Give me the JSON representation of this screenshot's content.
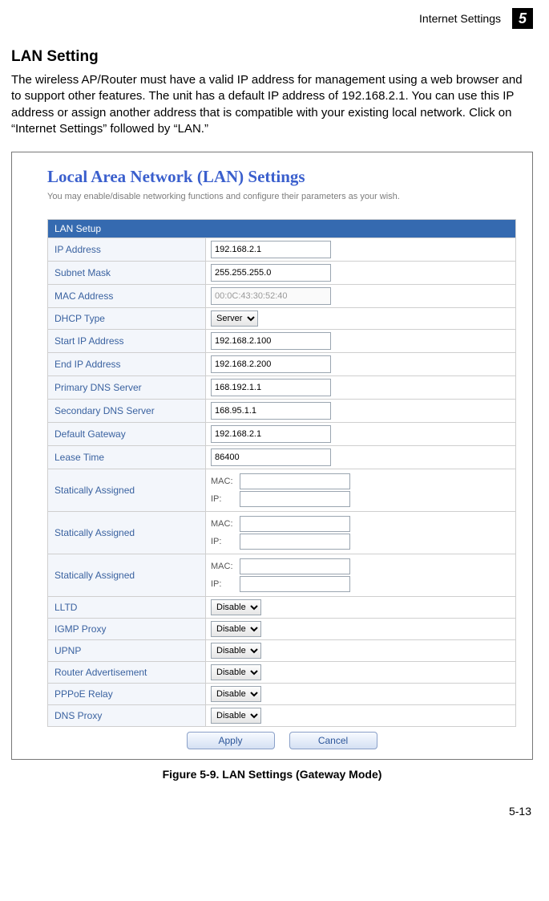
{
  "header": {
    "section_title": "Internet Settings",
    "chapter_number": "5"
  },
  "body": {
    "heading": "LAN Setting",
    "intro": "The wireless AP/Router must have a valid IP address for management using a web browser and to support other features. The unit has a default IP address of 192.168.2.1. You can use this IP address or assign another address that is compatible with your existing local network. Click on “Internet Settings” followed by “LAN.”"
  },
  "panel": {
    "title": "Local Area Network (LAN) Settings",
    "subtitle": "You may enable/disable networking functions and configure their parameters as your wish.",
    "table_header": "LAN Setup",
    "rows": {
      "ip_address": {
        "label": "IP Address",
        "value": "192.168.2.1"
      },
      "subnet_mask": {
        "label": "Subnet Mask",
        "value": "255.255.255.0"
      },
      "mac_address": {
        "label": "MAC Address",
        "value": "00:0C:43:30:52:40"
      },
      "dhcp_type": {
        "label": "DHCP Type",
        "value": "Server"
      },
      "start_ip": {
        "label": "Start IP Address",
        "value": "192.168.2.100"
      },
      "end_ip": {
        "label": "End IP Address",
        "value": "192.168.2.200"
      },
      "primary_dns": {
        "label": "Primary DNS Server",
        "value": "168.192.1.1"
      },
      "secondary_dns": {
        "label": "Secondary DNS Server",
        "value": "168.95.1.1"
      },
      "gateway": {
        "label": "Default Gateway",
        "value": "192.168.2.1"
      },
      "lease": {
        "label": "Lease Time",
        "value": "86400"
      },
      "static1": {
        "label": "Statically Assigned",
        "mac_label": "MAC:",
        "ip_label": "IP:"
      },
      "static2": {
        "label": "Statically Assigned",
        "mac_label": "MAC:",
        "ip_label": "IP:"
      },
      "static3": {
        "label": "Statically Assigned",
        "mac_label": "MAC:",
        "ip_label": "IP:"
      },
      "lltd": {
        "label": "LLTD",
        "value": "Disable"
      },
      "igmp": {
        "label": "IGMP Proxy",
        "value": "Disable"
      },
      "upnp": {
        "label": "UPNP",
        "value": "Disable"
      },
      "radv": {
        "label": "Router Advertisement",
        "value": "Disable"
      },
      "pppoe": {
        "label": "PPPoE Relay",
        "value": "Disable"
      },
      "dnsproxy": {
        "label": "DNS Proxy",
        "value": "Disable"
      }
    },
    "buttons": {
      "apply": "Apply",
      "cancel": "Cancel"
    }
  },
  "caption": "Figure 5-9.   LAN Settings (Gateway Mode)",
  "page_number": "5-13"
}
